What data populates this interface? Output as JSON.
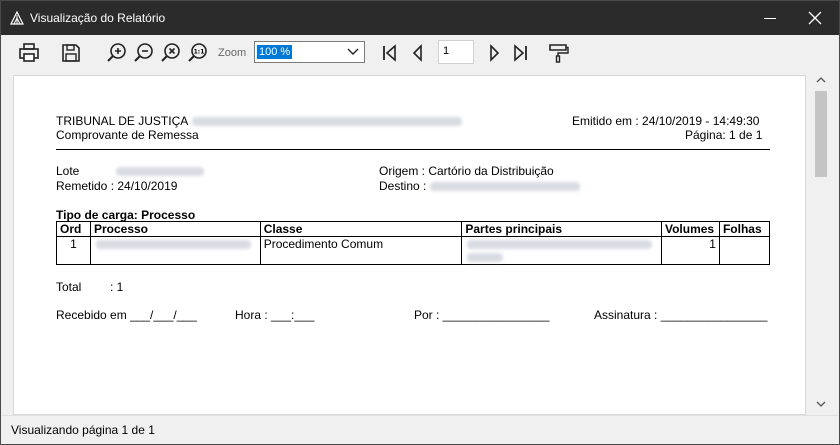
{
  "window": {
    "title": "Visualização do Relatório"
  },
  "toolbar": {
    "zoom_label": "Zoom",
    "zoom_value": "100 %",
    "page_number": "1",
    "icons": [
      "printer-icon",
      "save-icon",
      "zoom-in-icon",
      "zoom-out-icon",
      "zoom-reset-icon",
      "zoom-fit-icon",
      "first-page-icon",
      "previous-page-icon",
      "next-page-icon",
      "last-page-icon",
      "paint-roller-icon"
    ]
  },
  "report": {
    "court": "TRIBUNAL DE JUSTIÇA",
    "doc_title": "Comprovante de Remessa",
    "issued": "Emitido em : 24/10/2019 - 14:49:30",
    "page": "Página: 1 de 1",
    "lote_label": "Lote",
    "remetido": "Remetido : 24/10/2019",
    "origem": "Origem : Cartório da Distribuição",
    "destino_label": "Destino :",
    "tipo_carga": "Tipo de carga: Processo",
    "table": {
      "headers": [
        "Ord",
        "Processo",
        "Classe",
        "Partes principais",
        "Volumes",
        "Folhas"
      ],
      "rows": [
        {
          "ord": "1",
          "classe": "Procedimento Comum",
          "volumes": "1",
          "folhas": ""
        }
      ]
    },
    "total_label": "Total",
    "total_value": ": 1",
    "recebido": "Recebido em ___/___/___",
    "hora": "Hora : ___:___",
    "por": "Por : ________________",
    "assinatura": "Assinatura : ________________"
  },
  "status": {
    "text": "Visualizando página 1 de 1"
  }
}
